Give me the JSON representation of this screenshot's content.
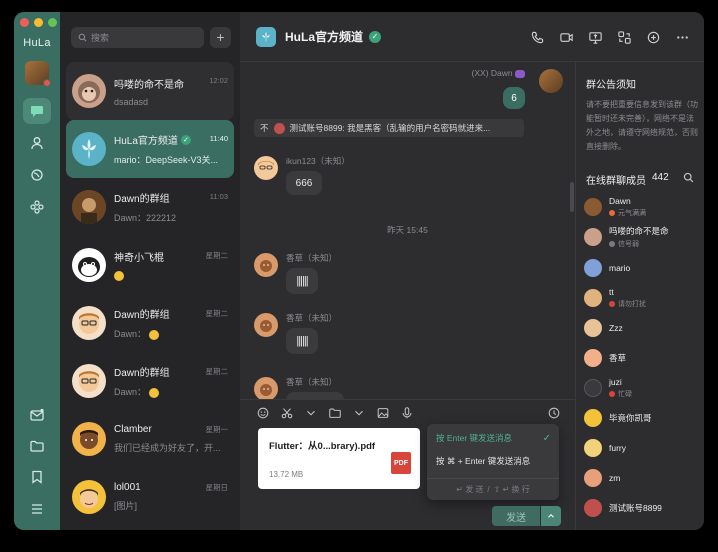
{
  "app": {
    "brand": "HuLa"
  },
  "search": {
    "placeholder": "搜索"
  },
  "conversations": [
    {
      "name": "吗喽的命不是命",
      "time": "12:02",
      "preview": "dsadasd",
      "pinned": true,
      "avatar_color": "#c9a08a"
    },
    {
      "name": "HuLa官方频道",
      "time": "11:40",
      "preview": "mario：DeepSeek-V3关...",
      "active": true,
      "verified": true,
      "avatar_color": "#5bb3c8"
    },
    {
      "name": "Dawn的群组",
      "time": "11:03",
      "preview": "Dawn：222212",
      "avatar_color": "#8a5a32"
    },
    {
      "name": "神奇小飞棍",
      "time": "星期二",
      "preview": "",
      "avatar_color": "#ffffff"
    },
    {
      "name": "Dawn的群组",
      "time": "星期二",
      "preview": "Dawn：",
      "avatar_color": "#f4c99a"
    },
    {
      "name": "Dawn的群组",
      "time": "星期二",
      "preview": "Dawn：",
      "avatar_color": "#f4c99a"
    },
    {
      "name": "Clamber",
      "time": "星期一",
      "preview": "我们已经成为好友了，开...",
      "avatar_color": "#f1b24a"
    },
    {
      "name": "lol001",
      "time": "星期日",
      "preview": "[图片]",
      "avatar_color": "#f3c23a"
    }
  ],
  "chat": {
    "title": "HuLa官方频道",
    "messages": {
      "me": {
        "nick": "(XX) Dawn",
        "text": "6"
      },
      "notice": {
        "prefix": "不",
        "text": "测试账号8899:  我是黑客（乱输的用户名密码就进来..."
      },
      "m1": {
        "nick": "ikun123（未知）",
        "text": "666"
      },
      "divider": "昨天 15:45",
      "m2": {
        "nick": "香草（未知）"
      },
      "m3": {
        "nick": "香草（未知）"
      },
      "m4": {
        "nick": "香草（未知）"
      }
    },
    "file": {
      "name": "Flutter：从0...brary).pdf",
      "size": "13.72 MB",
      "type": "PDF"
    },
    "send_menu": {
      "option1": "按 Enter 键发送消息",
      "option2": "按 ⌘ + Enter 键发送消息",
      "footer_send": "↵ 发 送",
      "footer_sep": "/",
      "footer_newline": "⇧ ↵ 换 行"
    },
    "send_label": "发送"
  },
  "sidebar": {
    "notice_title": "群公告须知",
    "notice_text": "请不要把重要信息发到该群（功能暂时还未完善），网络不是法外之地，请遵守网络规范，否则直接删除。",
    "online_label": "在线群聊成员",
    "online_count": "442",
    "members": [
      {
        "name": "Dawn",
        "status": "元气满满",
        "status_color": "#e86a3a",
        "avatar_color": "#8a5a32"
      },
      {
        "name": "吗喽的命不是命",
        "status": "信号弱",
        "status_color": "#7a7a80",
        "avatar_color": "#c9a08a"
      },
      {
        "name": "mario",
        "status": "",
        "avatar_color": "#7fa0d8"
      },
      {
        "name": "tt",
        "status": "请勿打扰",
        "status_color": "#d8463b",
        "avatar_color": "#e0b27d"
      },
      {
        "name": "Zzz",
        "status": "",
        "avatar_color": "#e8c39a"
      },
      {
        "name": "香草",
        "status": "",
        "avatar_color": "#f2b08a"
      },
      {
        "name": "juzi",
        "status": "忙碌",
        "status_color": "#d8463b",
        "avatar_color": "#3a3a3e"
      },
      {
        "name": "毕竟你凯哥",
        "status": "",
        "avatar_color": "#f3c23a"
      },
      {
        "name": "furry",
        "status": "",
        "avatar_color": "#f1d27a"
      },
      {
        "name": "zm",
        "status": "",
        "avatar_color": "#e8a07a"
      },
      {
        "name": "测试账号8899",
        "status": "",
        "avatar_color": "#c0504d"
      }
    ]
  }
}
